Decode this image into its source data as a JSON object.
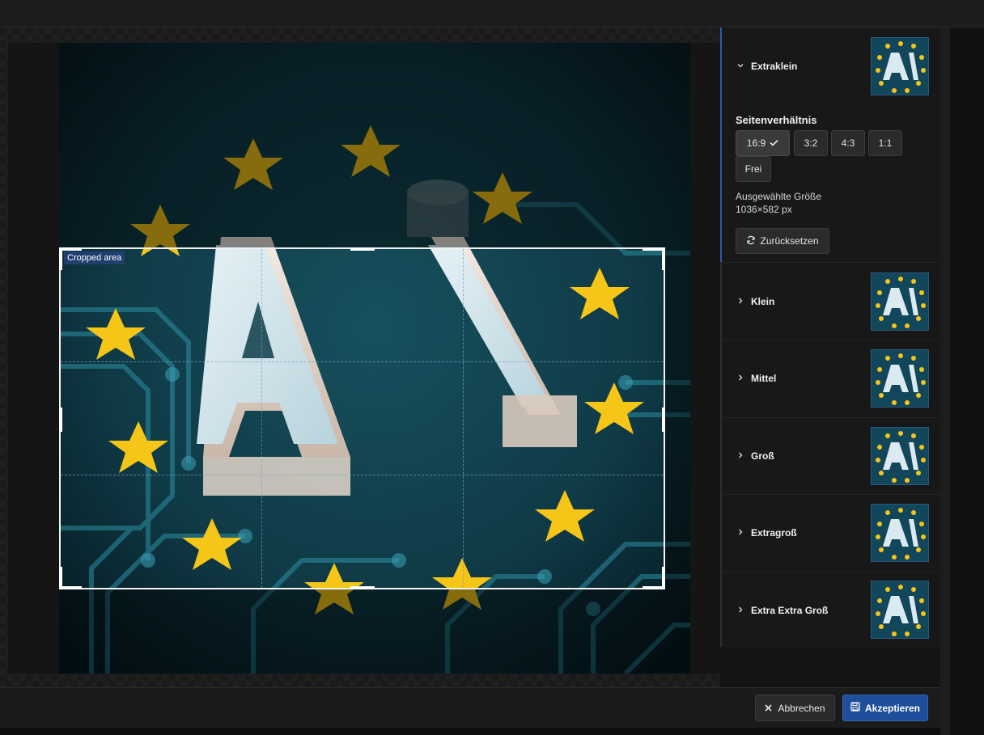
{
  "crop": {
    "label": "Cropped area"
  },
  "panel": {
    "active_section": {
      "label": "Extraklein"
    },
    "aspect_ratio_title": "Seitenverhältnis",
    "ratios": [
      {
        "label": "16:9",
        "selected": true
      },
      {
        "label": "3:2",
        "selected": false
      },
      {
        "label": "4:3",
        "selected": false
      },
      {
        "label": "1:1",
        "selected": false
      },
      {
        "label": "Frei",
        "selected": false
      }
    ],
    "selected_size_label": "Ausgewählte Größe",
    "selected_size_value": "1036×582 px",
    "reset_label": "Zurücksetzen",
    "sections": [
      {
        "label": "Klein"
      },
      {
        "label": "Mittel"
      },
      {
        "label": "Groß"
      },
      {
        "label": "Extragroß"
      },
      {
        "label": "Extra Extra Groß"
      }
    ]
  },
  "footer": {
    "cancel_label": "Abbrechen",
    "accept_label": "Akzeptieren"
  },
  "icons": {
    "chevron_down": "chevron-down-icon",
    "chevron_right": "chevron-right-icon",
    "check": "check-icon",
    "reset": "refresh-icon",
    "close": "close-icon",
    "save": "save-icon"
  },
  "colors": {
    "accent": "#1f4f9a",
    "star": "#f5c518",
    "letters": "#dce9f0",
    "background": "#0d3540"
  }
}
